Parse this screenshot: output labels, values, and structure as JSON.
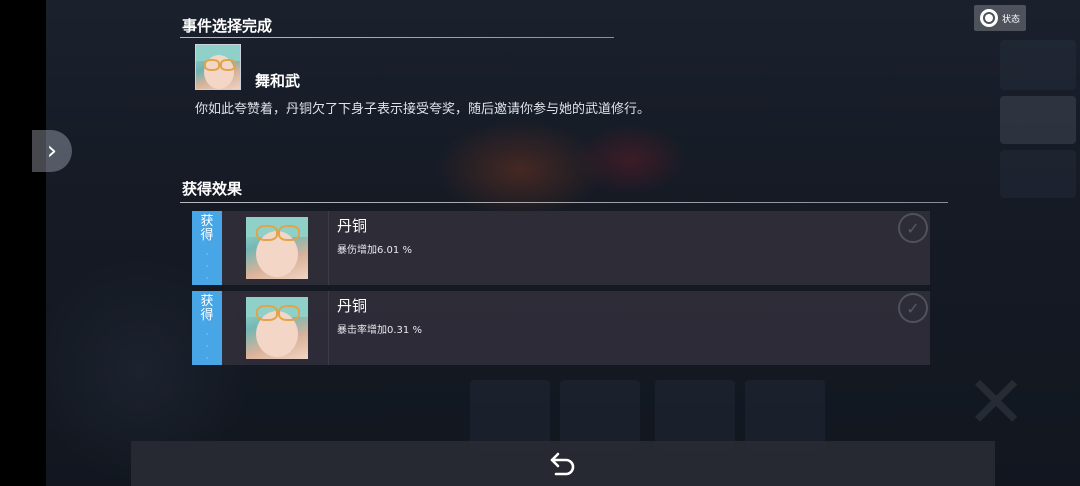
{
  "event": {
    "header": "事件选择完成",
    "speaker": "舞和武",
    "description": "你如此夸赞着，丹铜欠了下身子表示接受夸奖，随后邀请你参与她的武道修行。"
  },
  "effects": {
    "header": "获得效果",
    "items": [
      {
        "tag": "获得",
        "name": "丹铜",
        "effect": "暴伤增加6.01 %"
      },
      {
        "tag": "获得",
        "name": "丹铜",
        "effect": "暴击率增加0.31 %"
      }
    ]
  },
  "status_button": {
    "label": "状态",
    "icon": "status-icon"
  },
  "icons": {
    "side": "chevron-right-icon",
    "back": "return-arrow-icon",
    "check": "check-icon"
  },
  "colors": {
    "tag_blue": "#48a6e6",
    "panel": "#302e3a"
  }
}
